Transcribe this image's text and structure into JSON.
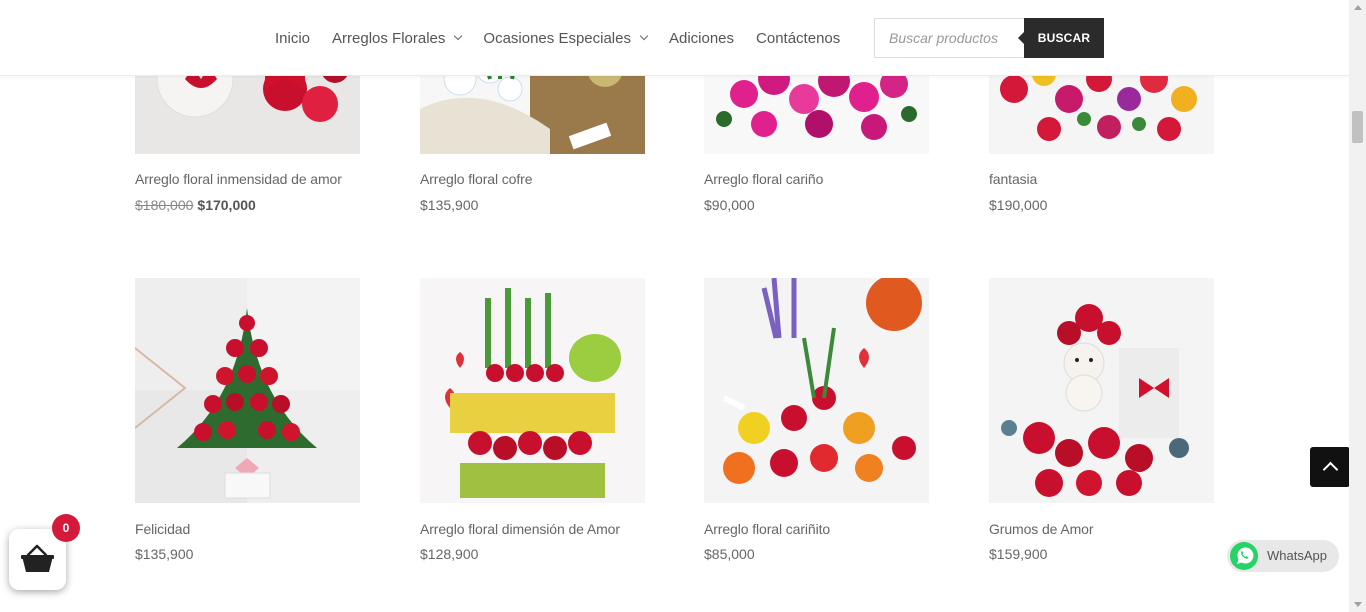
{
  "header": {
    "nav": [
      {
        "label": "Inicio",
        "dropdown": false
      },
      {
        "label": "Arreglos Florales",
        "dropdown": true
      },
      {
        "label": "Ocasiones Especiales",
        "dropdown": true
      },
      {
        "label": "Adiciones",
        "dropdown": false
      },
      {
        "label": "Contáctenos",
        "dropdown": false
      }
    ],
    "search": {
      "placeholder": "Buscar productos",
      "button_label": "BUSCAR"
    }
  },
  "products": [
    {
      "name": "Arreglo floral inmensidad de amor",
      "old_price": "$180,000",
      "price": "$170,000",
      "on_sale": true
    },
    {
      "name": "Arreglo floral cofre",
      "price": "$135,900"
    },
    {
      "name": "Arreglo floral cariño",
      "price": "$90,000"
    },
    {
      "name": "fantasia",
      "price": "$190,000"
    },
    {
      "name": "Felicidad",
      "price": "$135,900"
    },
    {
      "name": "Arreglo floral dimensión de Amor",
      "price": "$128,900"
    },
    {
      "name": "Arreglo floral cariñito",
      "price": "$85,000"
    },
    {
      "name": "Grumos de Amor",
      "price": "$159,900"
    }
  ],
  "cart": {
    "count": "0",
    "icon": "basket-icon"
  },
  "whatsapp": {
    "label": "WhatsApp"
  },
  "colors": {
    "sale_badge": "#d5193a",
    "search_button": "#2b2b2b",
    "whatsapp_green": "#25d366"
  }
}
